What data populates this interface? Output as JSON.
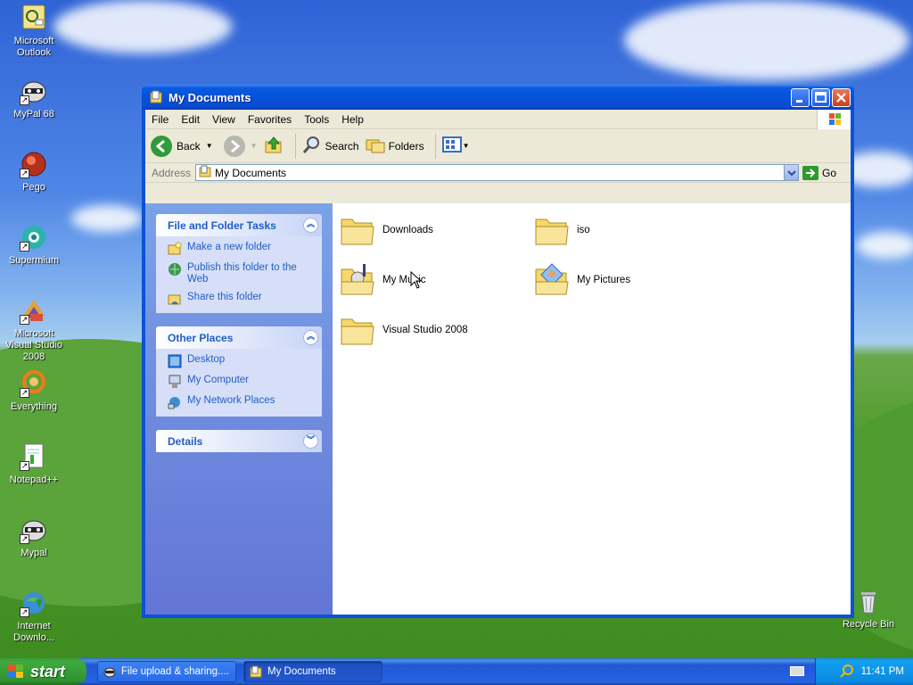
{
  "desktop": {
    "icons": [
      {
        "label": "Microsoft Outlook",
        "icon": "outlook-icon"
      },
      {
        "label": "MyPal 68",
        "icon": "mypal-icon"
      },
      {
        "label": "Pego",
        "icon": "pego-icon"
      },
      {
        "label": "Supermium",
        "icon": "supermium-icon"
      },
      {
        "label": "Microsoft Visual Studio 2008",
        "icon": "visual-studio-icon"
      },
      {
        "label": "Everything",
        "icon": "everything-icon"
      },
      {
        "label": "Notepad++",
        "icon": "notepadpp-icon"
      },
      {
        "label": "Mypal",
        "icon": "mypal-icon"
      },
      {
        "label": "Internet Downlo...",
        "icon": "internet-download-icon"
      }
    ],
    "recycle_bin": "Recycle Bin"
  },
  "window": {
    "title": "My Documents",
    "menu": [
      "File",
      "Edit",
      "View",
      "Favorites",
      "Tools",
      "Help"
    ],
    "toolbar": {
      "back": "Back",
      "search": "Search",
      "folders": "Folders"
    },
    "address": {
      "label": "Address",
      "value": "My Documents",
      "go": "Go"
    },
    "taskpane": {
      "file_tasks": {
        "title": "File and Folder Tasks",
        "items": [
          "Make a new folder",
          "Publish this folder to the Web",
          "Share this folder"
        ]
      },
      "other_places": {
        "title": "Other Places",
        "items": [
          "Desktop",
          "My Computer",
          "My Network Places"
        ]
      },
      "details": {
        "title": "Details"
      }
    },
    "files": [
      "Downloads",
      "iso",
      "My Music",
      "My Pictures",
      "Visual Studio 2008"
    ]
  },
  "taskbar": {
    "start": "start",
    "tasks": [
      "File upload & sharing....",
      "My Documents"
    ],
    "clock": "11:41 PM"
  },
  "colors": {
    "titlebar": "#0552db",
    "taskpane_link": "#215dc6",
    "start_button": "#3dab3d",
    "tray": "#0c87e0"
  }
}
